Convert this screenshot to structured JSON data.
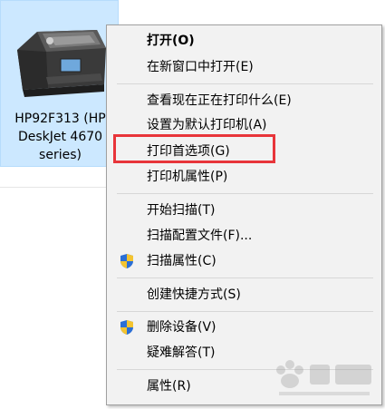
{
  "device": {
    "label": "HP92F313 (HP\nDeskJet 4670\nseries)"
  },
  "menu": {
    "items": [
      {
        "label": "打开(O)",
        "bold": true,
        "shield": false
      },
      {
        "label": "在新窗口中打开(E)",
        "bold": false,
        "shield": false
      },
      {
        "label": "查看现在正在打印什么(E)",
        "bold": false,
        "shield": false
      },
      {
        "label": "设置为默认打印机(A)",
        "bold": false,
        "shield": false
      },
      {
        "label": "打印首选项(G)",
        "bold": false,
        "shield": false
      },
      {
        "label": "打印机属性(P)",
        "bold": false,
        "shield": false
      },
      {
        "label": "开始扫描(T)",
        "bold": false,
        "shield": false
      },
      {
        "label": "扫描配置文件(F)...",
        "bold": false,
        "shield": false
      },
      {
        "label": "扫描属性(C)",
        "bold": false,
        "shield": true
      },
      {
        "label": "创建快捷方式(S)",
        "bold": false,
        "shield": false
      },
      {
        "label": "删除设备(V)",
        "bold": false,
        "shield": true
      },
      {
        "label": "疑难解答(T)",
        "bold": false,
        "shield": false
      },
      {
        "label": "属性(R)",
        "bold": false,
        "shield": false
      }
    ]
  },
  "highlight_color": "#e8353a",
  "icons": {
    "device": "printer-icon",
    "uac": "shield-icon"
  }
}
